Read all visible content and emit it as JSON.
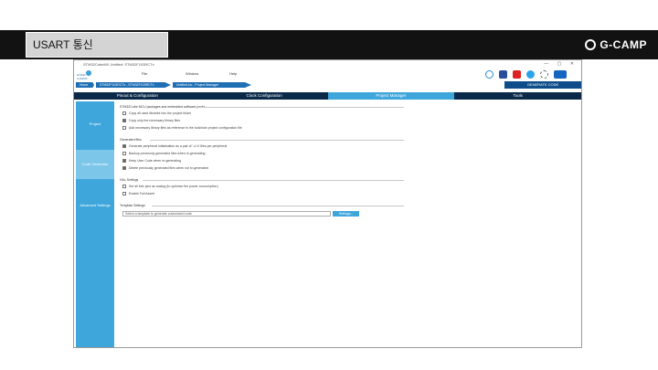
{
  "banner": {
    "title": "USART 통신",
    "brand": "G-CAMP"
  },
  "window": {
    "title": "STM32CubeMX Untitled: STM32F103RCTx",
    "controls": "—  ▢  ✕"
  },
  "logo": {
    "line1": "STM32",
    "line2": "CubeMX"
  },
  "menu": [
    {
      "label": "File"
    },
    {
      "label": "Window"
    },
    {
      "label": "Help"
    }
  ],
  "breadcrumbs": [
    {
      "label": "Home"
    },
    {
      "label": "STM32F103RCTx - STM32F103RCTx"
    },
    {
      "label": "Untitled.ioc - Project Manager"
    }
  ],
  "generate_label": "GENERATE CODE",
  "tabs": [
    {
      "label": "Pinout & Configuration"
    },
    {
      "label": "Clock Configuration"
    },
    {
      "label": "Project Manager"
    },
    {
      "label": "Tools"
    }
  ],
  "sidebar": [
    {
      "label": "Project"
    },
    {
      "label": "Code Generator"
    },
    {
      "label": "Advanced Settings"
    }
  ],
  "groups": [
    {
      "title": "STM32Cube MCU packages and embedded software packs",
      "options": [
        {
          "label": "Copy all used libraries into the project folder",
          "checked": false
        },
        {
          "label": "Copy only the necessary library files",
          "checked": true
        },
        {
          "label": "Add necessary library files as reference in the toolchain project configuration file",
          "checked": false
        }
      ]
    },
    {
      "title": "Generated files",
      "options": [
        {
          "label": "Generate peripheral initialization as a pair of '.c/.h' files per peripheral",
          "checked": true
        },
        {
          "label": "Backup previously generated files when re-generating",
          "checked": false
        },
        {
          "label": "Keep User Code when re-generating",
          "checked": true
        },
        {
          "label": "Delete previously generated files when not re-generated",
          "checked": true
        }
      ]
    },
    {
      "title": "HAL Settings",
      "options": [
        {
          "label": "Set all free pins as analog (to optimize the power consumption)",
          "checked": false
        },
        {
          "label": "Enable Full Assert",
          "checked": false
        }
      ]
    },
    {
      "title": "Template Settings",
      "options": []
    }
  ],
  "template": {
    "placeholder": "Select a template to generate customized code",
    "button": "Settings..."
  },
  "colors": {
    "banner": "#121212",
    "accent": "#3fa6dc",
    "tabbar": "#0b2a4a",
    "generate": "#0e4d8a"
  }
}
